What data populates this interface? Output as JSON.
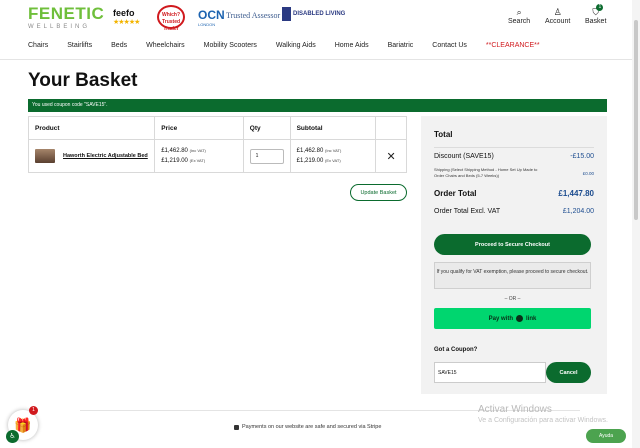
{
  "brand": {
    "name": "FENETIC",
    "tagline": "WELLBEING",
    "accent": "#0b6b2e",
    "logo_green": "#6fbf3b"
  },
  "badges": {
    "feefo": "feefo",
    "feefo_stars": "★★★★★",
    "which": "Which? Trusted Trader",
    "ocn": "OCN",
    "ocn_sub": "LONDON",
    "trusted": "Trusted Assessor",
    "disabled_living": "DISABLED LIVING"
  },
  "header_actions": [
    {
      "label": "Search",
      "icon": "search-icon",
      "glyph": "⌕"
    },
    {
      "label": "Account",
      "icon": "user-icon",
      "glyph": "♙"
    },
    {
      "label": "Basket",
      "icon": "basket-icon",
      "glyph": "⛉",
      "count": "1"
    }
  ],
  "nav": [
    "Chairs",
    "Stairlifts",
    "Beds",
    "Wheelchairs",
    "Mobility Scooters",
    "Walking Aids",
    "Home Aids",
    "Bariatric",
    "Contact Us",
    "**CLEARANCE**"
  ],
  "page": {
    "title": "Your Basket",
    "coupon_notice": "You used coupon code \"SAVE15\"."
  },
  "cart": {
    "headers": [
      "Product",
      "Price",
      "Qty",
      "Subtotal",
      ""
    ],
    "item": {
      "name": "Haworth Electric Adjustable Bed",
      "price_inc": "£1,462.80",
      "price_inc_note": "(Inc VAT)",
      "price_ex": "£1,219.00",
      "price_ex_note": "(Ex VAT)",
      "qty": "1",
      "subtotal_inc": "£1,462.80",
      "subtotal_inc_note": "(Inc VAT)",
      "subtotal_ex": "£1,219.00",
      "subtotal_ex_note": "(Ex VAT)"
    },
    "update_label": "Update Basket"
  },
  "totals": {
    "title": "Total",
    "discount_label": "Discount (SAVE15)",
    "discount_value": "-£15.00",
    "shipping_label": "Shipping (Select Shipping Method - Home Set Up Made to Order Chairs and Beds (5-7 Weeks))",
    "shipping_value": "£0.00",
    "order_total_label": "Order Total",
    "order_total_value": "£1,447.80",
    "excl_vat_label": "Order Total Excl. VAT",
    "excl_vat_value": "£1,204.00",
    "checkout_label": "Proceed to Secure Checkout",
    "vat_note": "If you qualify for VAT exemption, please proceed to secure checkout.",
    "or_label": "– OR –",
    "pay_prefix": "Pay with",
    "pay_brand": "link",
    "coupon_label": "Got a Coupon?",
    "coupon_value": "SAVE15",
    "cancel_label": "Cancel"
  },
  "footer": {
    "secure_text": "Payments on our website are safe and secured via Stripe",
    "gift_count": "1",
    "help_label": "Ayuda"
  },
  "watermark": {
    "line1": "Activar Windows",
    "line2": "Ve a Configuración para activar Windows."
  }
}
